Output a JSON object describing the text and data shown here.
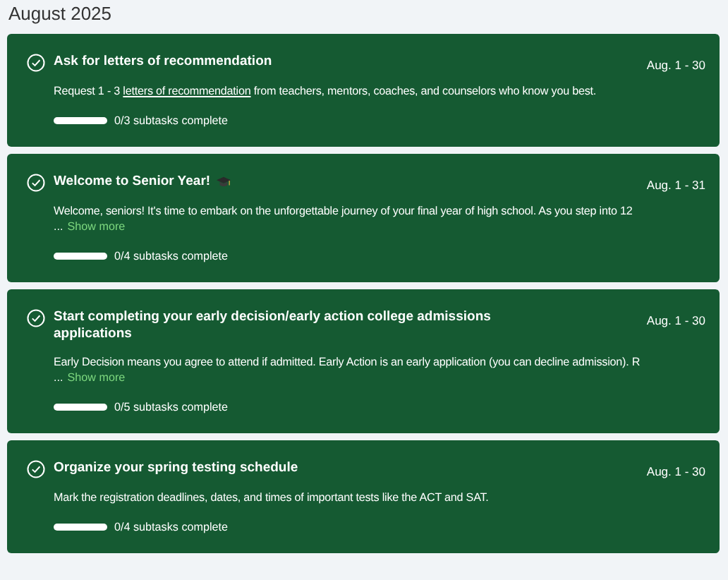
{
  "month": "August 2025",
  "tasks": [
    {
      "title": "Ask for letters of recommendation",
      "date": "Aug. 1 - 30",
      "description": [
        {
          "kind": "text",
          "text": "Request 1 - 3 "
        },
        {
          "kind": "link",
          "text": "letters of recommendation"
        },
        {
          "kind": "text",
          "text": " from teachers, mentors, coaches, and counselors who know you best."
        }
      ],
      "progress": {
        "level": 0,
        "label": "0/3 subtasks complete"
      }
    },
    {
      "title": "Welcome to Senior Year!",
      "cap_icon": true,
      "date": "Aug. 1 - 31",
      "description": [
        {
          "kind": "text",
          "text": "Welcome, seniors! It's time to embark on the unforgettable journey of your final year of high school. As you step into 12"
        }
      ],
      "ellipsis": "...",
      "show_more": "Show more",
      "progress": {
        "level": 0,
        "label": "0/4 subtasks complete"
      }
    },
    {
      "title": "Start completing your early decision/early action college admissions applications",
      "date": "Aug. 1 - 30",
      "description": [
        {
          "kind": "text",
          "text": "Early Decision means you agree to attend if admitted. Early Action is an early application (you can decline admission). R"
        }
      ],
      "ellipsis": "...",
      "show_more": "Show more",
      "progress": {
        "level": 0,
        "label": "0/5 subtasks complete"
      }
    },
    {
      "title": "Organize your spring testing schedule",
      "date": "Aug. 1 - 30",
      "description": [
        {
          "kind": "text",
          "text": "Mark the registration deadlines, dates, and times of important tests like the ACT and SAT."
        }
      ],
      "progress": {
        "level": 0,
        "label": "0/4 subtasks complete"
      }
    }
  ]
}
